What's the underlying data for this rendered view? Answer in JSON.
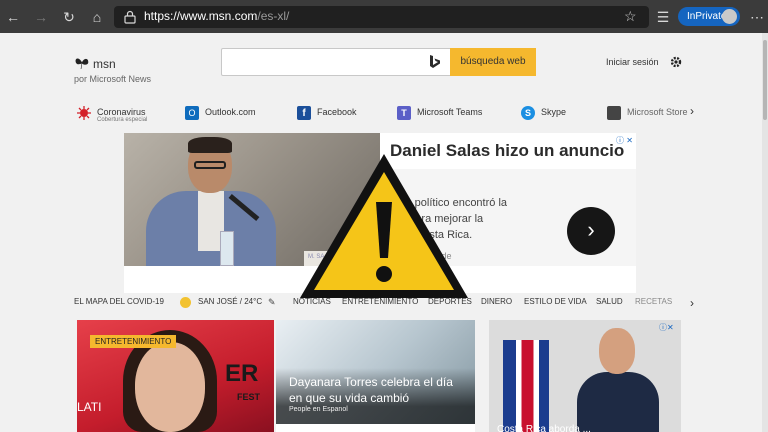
{
  "browser": {
    "url_main": "https://www.msn.com",
    "url_path": "/es-xl/",
    "inprivate_label": "InPrivate",
    "icons": [
      "back-icon",
      "forward-icon",
      "refresh-icon",
      "home-icon",
      "lock-icon",
      "star-icon",
      "favorites-icon",
      "more-icon"
    ]
  },
  "header": {
    "logo_text": "msn",
    "logo_sub": "por Microsoft News",
    "search_placeholder": "",
    "search_button": "búsqueda web",
    "signin": "Iniciar sesión"
  },
  "quick_links": [
    {
      "label": "Coronavirus",
      "sub": "Cobertura especial",
      "color": "#d42029"
    },
    {
      "label": "Outlook.com",
      "sub": "",
      "color": "#0f6cbd"
    },
    {
      "label": "Facebook",
      "sub": "",
      "color": "#1b4f9a"
    },
    {
      "label": "Microsoft Teams",
      "sub": "",
      "color": "#5b5fc7"
    },
    {
      "label": "Skype",
      "sub": "",
      "color": "#1b8fe2"
    },
    {
      "label": "Microsoft Store",
      "sub": "",
      "color": "#444444"
    }
  ],
  "ad": {
    "title": "Daniel Salas hizo un anuncio",
    "body_line1": "so político encontró la",
    "body_line2": "n para mejorar la",
    "body_line3": "de Costa Rica.",
    "source": "mde",
    "banner_text": "M. SA"
  },
  "topics": {
    "covid": "EL MAPA DEL COVID-19",
    "weather": "SAN JOSÉ / 24°C",
    "items": [
      "NOTICIAS",
      "ENTRETENIMIENTO",
      "DEPORTES",
      "DINERO",
      "ESTILO DE VIDA",
      "SALUD",
      "RECETAS"
    ]
  },
  "cards": {
    "card1_badge": "ENTRETENIMIENTO",
    "card1_sign": "ER",
    "card1_sign2": "FEST",
    "card1_lati": "LATI",
    "card2_title": "Dayanara Torres celebra el día en que su vida cambió",
    "card2_source": "People en Espanol",
    "card3_caption": "Costa Rica aborda ..."
  },
  "colors": {
    "chrome": "#3b3b3b",
    "accent_search": "#f5b82e",
    "inprivate": "#1565c0",
    "warning_yellow": "#f5c518"
  }
}
